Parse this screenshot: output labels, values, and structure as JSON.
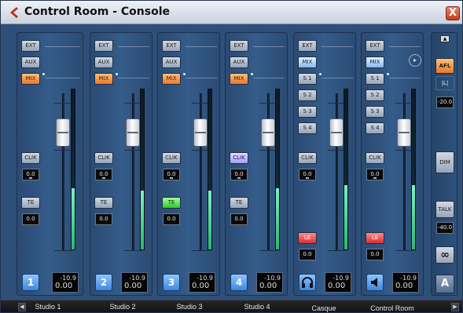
{
  "window": {
    "title": "Control Room - Console",
    "close_glyph": "X"
  },
  "strips": [
    {
      "route": [
        "EXT",
        "AUX",
        "MIX"
      ],
      "click": "CLIK",
      "click_value": "0.0",
      "te": "TE",
      "te_value": "0.0",
      "number": "1",
      "peak": "-10.9",
      "level": "0.00",
      "name": "Studio 1",
      "meter_fill": 0.38
    },
    {
      "route": [
        "EXT",
        "AUX",
        "MIX"
      ],
      "click": "CLIK",
      "click_value": "0.0",
      "te": "TE",
      "te_value": "0.0",
      "number": "2",
      "peak": "-10.9",
      "level": "0.00",
      "name": "Studio 2",
      "meter_fill": 0.37
    },
    {
      "route": [
        "EXT",
        "AUX",
        "MIX"
      ],
      "click": "CLIK",
      "click_value": "0.0",
      "te": "TE",
      "te_value": "0.0",
      "number": "3",
      "peak": "-10.9",
      "level": "0.00",
      "name": "Studio 3",
      "meter_fill": 0.37
    },
    {
      "route": [
        "EXT",
        "AUX",
        "MIX"
      ],
      "click": "CLIK",
      "click_value": "0.0",
      "te": "TE",
      "te_value": "0.0",
      "number": "4",
      "peak": "-10.9",
      "level": "0.00",
      "name": "Studio 4",
      "meter_fill": 0.38
    }
  ],
  "monitors": [
    {
      "route": [
        "EXT",
        "MIX",
        "S 1",
        "S 2",
        "S 3",
        "S 4"
      ],
      "click": "CLIK",
      "click_value": "0.0",
      "le": "LE",
      "le_value": "0.0",
      "icon": "headphones-icon",
      "peak": "-10.9",
      "level": "0.00",
      "name": "Casque",
      "meter_fill": 0.4
    },
    {
      "route": [
        "EXT",
        "MIX",
        "S 1",
        "S 2",
        "S 3",
        "S 4"
      ],
      "click": "CLIK",
      "click_value": "0.0",
      "le": "LE",
      "le_value": "0.0",
      "icon": "speaker-icon",
      "peak": "-10.9",
      "level": "0.00",
      "name": "Control Room",
      "meter_fill": 0.4
    }
  ],
  "right_panel": {
    "afl": "AFL",
    "mode": "|L|",
    "afl_value": "-20.0",
    "dim": "DIM",
    "talk": "TALK",
    "talk_value": "-40.0",
    "link_glyph": "∞",
    "a_label": "A"
  },
  "colors": {
    "orange_active": "#e9782a",
    "blue_active": "#88b8ec",
    "green_active": "#2dc82a",
    "purple_active": "#a8a0ee",
    "red_active": "#d43030",
    "meter": "#3ad388"
  }
}
